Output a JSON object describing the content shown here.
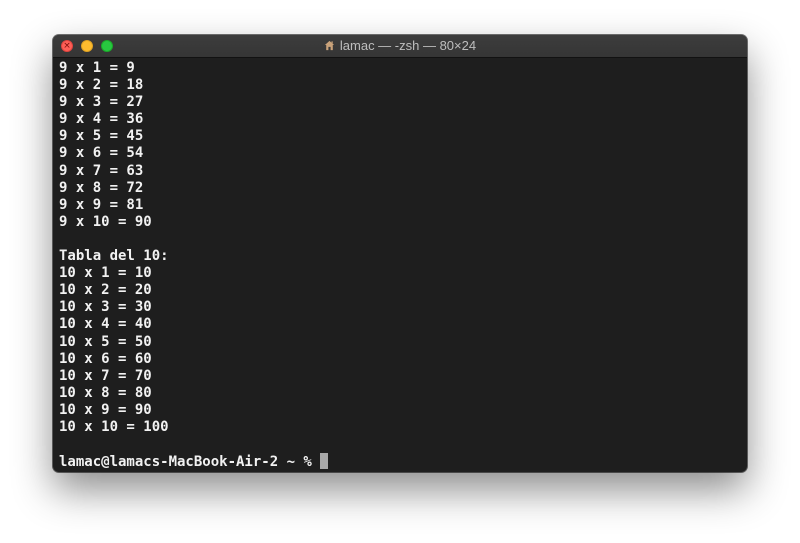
{
  "window": {
    "title": "lamac — -zsh — 80×24",
    "home_icon": "house-icon"
  },
  "terminal": {
    "lines": [
      "9 x 1 = 9",
      "9 x 2 = 18",
      "9 x 3 = 27",
      "9 x 4 = 36",
      "9 x 5 = 45",
      "9 x 6 = 54",
      "9 x 7 = 63",
      "9 x 8 = 72",
      "9 x 9 = 81",
      "9 x 10 = 90",
      "",
      "Tabla del 10:",
      "10 x 1 = 10",
      "10 x 2 = 20",
      "10 x 3 = 30",
      "10 x 4 = 40",
      "10 x 5 = 50",
      "10 x 6 = 60",
      "10 x 7 = 70",
      "10 x 8 = 80",
      "10 x 9 = 90",
      "10 x 10 = 100",
      ""
    ],
    "prompt": "lamac@lamacs-MacBook-Air-2 ~ % "
  },
  "colors": {
    "background": "#1e1e1e",
    "text": "#f2f2f2",
    "cursor": "#a8a8a8",
    "close": "#fe5f57",
    "minimize": "#febc2e",
    "zoom": "#28c840"
  }
}
